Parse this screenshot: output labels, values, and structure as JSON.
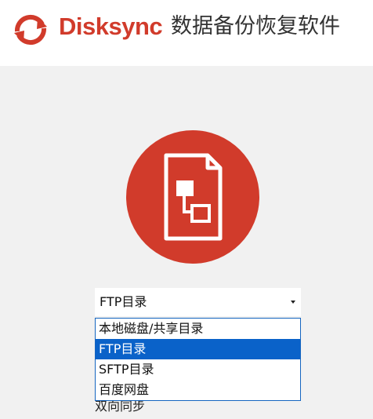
{
  "header": {
    "brand": "Disksync",
    "subtitle": "数据备份恢复软件",
    "logo_icon": "sync-icon",
    "brand_color": "#d13b2b"
  },
  "hero": {
    "icon": "file-transfer-icon",
    "circle_color": "#d13b2b"
  },
  "source_select": {
    "value": "FTP目录",
    "options": [
      "本地磁盘/共享目录",
      "FTP目录",
      "SFTP目录",
      "百度网盘"
    ],
    "selected_index": 1,
    "highlight_color": "#0a62c9"
  },
  "behind_text": "双向同步"
}
